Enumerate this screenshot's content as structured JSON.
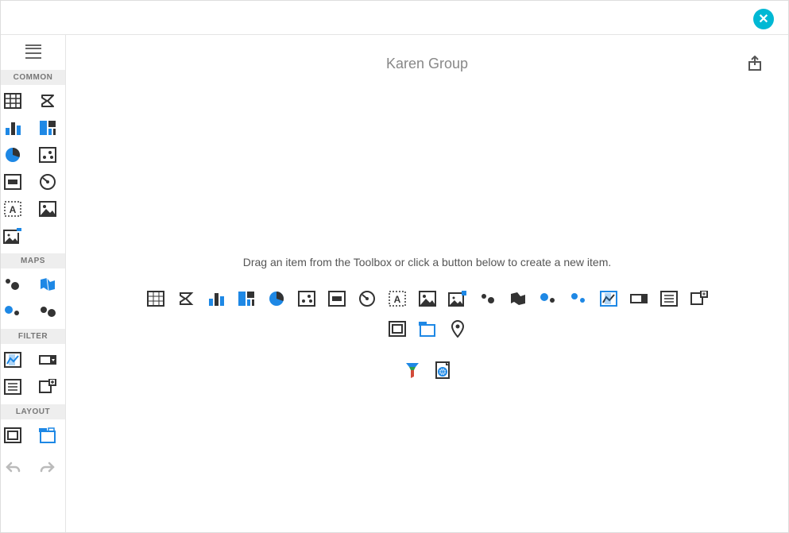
{
  "window": {
    "close_label": "✕"
  },
  "page": {
    "title": "Karen Group",
    "instruction": "Drag an item from the Toolbox or click a button below to create a new item."
  },
  "sidebar": {
    "sections": {
      "common": "COMMON",
      "maps": "MAPS",
      "filter": "FILTER",
      "layout": "LAYOUT"
    }
  },
  "colors": {
    "accent": "#1e88e5",
    "dark": "#333333",
    "muted": "#888888",
    "teal": "#00b8d4"
  },
  "toolbox": {
    "common": [
      "grid",
      "sigma",
      "bar-chart",
      "treemap",
      "pie-chart",
      "scatter",
      "card",
      "gauge",
      "textbox",
      "image",
      "bound-image"
    ],
    "maps": [
      "geo-dots-light",
      "geo-region",
      "geo-dots-blue",
      "geo-dots-dark"
    ],
    "filter": [
      "range-filter",
      "combo-filter",
      "list-filter",
      "tree-filter"
    ],
    "layout": [
      "group",
      "tab-container"
    ]
  },
  "palette": [
    "grid",
    "sigma",
    "bar-chart",
    "treemap",
    "pie-chart",
    "scatter",
    "card",
    "gauge",
    "textbox",
    "image",
    "bound-image",
    "geo-dots-dark",
    "geo-region",
    "geo-dots-blue",
    "geo-dots-light",
    "range-filter",
    "combo-filter",
    "list-filter",
    "tree-filter",
    "group",
    "tab-container",
    "pin",
    "funnel",
    "web-page"
  ]
}
